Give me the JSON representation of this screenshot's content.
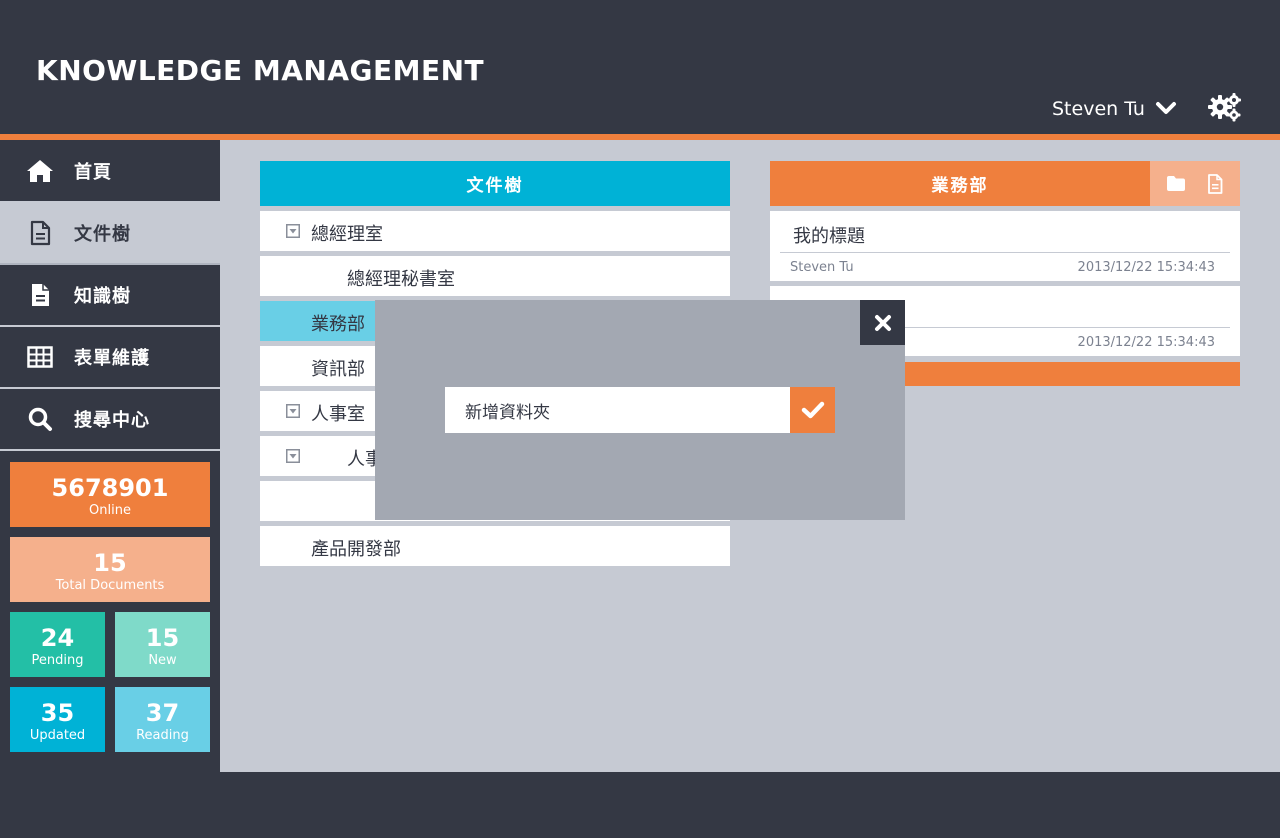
{
  "header": {
    "title": "KNOWLEDGE MANAGEMENT",
    "user_name": "Steven Tu",
    "settings_icon": "gears-icon"
  },
  "colors": {
    "dark": "#343844",
    "accent_orange": "#ef7f3d",
    "light_orange": "#f5b08c",
    "cyan": "#00b2d6",
    "light_cyan": "#69cfe6",
    "teal": "#23bfa6",
    "mint": "#7fdac9",
    "content_bg": "#c6cad3"
  },
  "sidebar": {
    "items": [
      {
        "label": "首頁",
        "icon": "home-icon"
      },
      {
        "label": "文件樹",
        "icon": "document-outline-icon"
      },
      {
        "label": "知識樹",
        "icon": "document-filled-icon"
      },
      {
        "label": "表單維護",
        "icon": "table-icon"
      },
      {
        "label": "搜尋中心",
        "icon": "search-icon"
      }
    ],
    "active_index": 1
  },
  "stats": {
    "online": {
      "value": "5678901",
      "label": "Online"
    },
    "total_documents": {
      "value": "15",
      "label": "Total Documents"
    },
    "pending": {
      "value": "24",
      "label": "Pending"
    },
    "new": {
      "value": "15",
      "label": "New"
    },
    "updated": {
      "value": "35",
      "label": "Updated"
    },
    "reading": {
      "value": "37",
      "label": "Reading"
    }
  },
  "tree": {
    "title": "文件樹",
    "rows": [
      {
        "label": "總經理室",
        "expandable": true
      },
      {
        "label": "總經理秘書室",
        "expandable": false
      },
      {
        "label": "業務部",
        "expandable": false,
        "selected": true
      },
      {
        "label": "資訊部",
        "expandable": false
      },
      {
        "label": "人事室",
        "expandable": true
      },
      {
        "label": "人事",
        "expandable": true
      },
      {
        "label": "",
        "expandable": false
      },
      {
        "label": "產品開發部",
        "expandable": false
      }
    ]
  },
  "detail": {
    "title": "業務部",
    "icons": [
      "folder-icon",
      "file-icon"
    ],
    "documents": [
      {
        "title": "我的標題",
        "author": "Steven Tu",
        "date": "2013/12/22 15:34:43"
      },
      {
        "title": "",
        "author": "",
        "date": "2013/12/22 15:34:43"
      }
    ]
  },
  "modal": {
    "input_value": "新增資料夾",
    "close_icon": "close-icon",
    "confirm_icon": "checkmark-icon"
  }
}
